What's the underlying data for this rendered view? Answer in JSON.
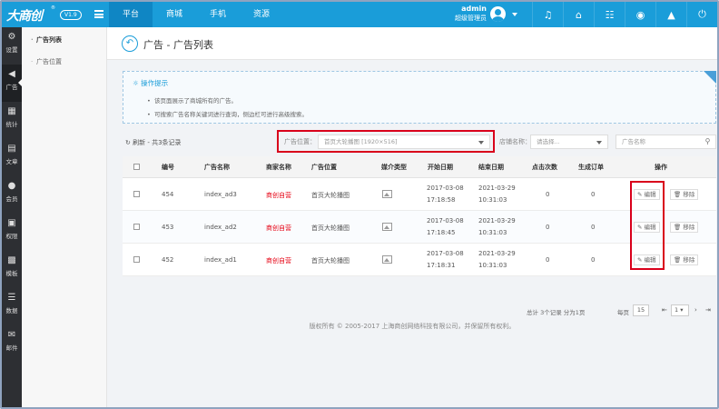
{
  "header": {
    "logo": "大商创",
    "logo_reg": "®",
    "version": "V1.9",
    "nav": [
      "平台",
      "商城",
      "手机",
      "资源"
    ],
    "user_name": "admin",
    "user_role": "超级管理员",
    "icons": [
      "bell-icon",
      "home-icon",
      "sitemap-icon",
      "palette-icon",
      "broom-icon",
      "power-icon"
    ]
  },
  "sidebar": {
    "items": [
      {
        "label": "设置",
        "icon": "gear-icon"
      },
      {
        "label": "广告",
        "icon": "speaker-icon"
      },
      {
        "label": "统计",
        "icon": "chart-icon"
      },
      {
        "label": "文章",
        "icon": "file-icon"
      },
      {
        "label": "会员",
        "icon": "user-icon"
      },
      {
        "label": "权限",
        "icon": "lock-icon"
      },
      {
        "label": "模板",
        "icon": "grid-icon"
      },
      {
        "label": "数据",
        "icon": "database-icon"
      },
      {
        "label": "邮件",
        "icon": "mail-icon"
      }
    ]
  },
  "submenu": {
    "items": [
      "广告列表",
      "广告位置"
    ]
  },
  "page": {
    "title": "广告 - 广告列表"
  },
  "tips": {
    "title": "操作提示",
    "lines": [
      "该页面展示了商城所有的广告。",
      "可搜索广告名称关键词进行查询，侧边栏可进行高级搜索。"
    ]
  },
  "toolbar": {
    "refresh": "刷新 - 共3条记录",
    "position_label": "广告位置：",
    "position_value": "首页大轮播图 [1920×516]",
    "shop_label": "店铺名称：",
    "shop_placeholder": "请选择...",
    "name_placeholder": "广告名称"
  },
  "table": {
    "headers": [
      "编号",
      "广告名称",
      "商家名称",
      "广告位置",
      "媒介类型",
      "开始日期",
      "结束日期",
      "点击次数",
      "生成订单",
      "操作"
    ],
    "rows": [
      {
        "id": "454",
        "name": "index_ad3",
        "shop": "商创自营",
        "position": "首页大轮播图",
        "start_date": "2017-03-08",
        "start_time": "17:18:58",
        "end_date": "2021-03-29",
        "end_time": "10:31:03",
        "clicks": "0",
        "orders": "0"
      },
      {
        "id": "453",
        "name": "index_ad2",
        "shop": "商创自营",
        "position": "首页大轮播图",
        "start_date": "2017-03-08",
        "start_time": "17:18:45",
        "end_date": "2021-03-29",
        "end_time": "10:31:03",
        "clicks": "0",
        "orders": "0"
      },
      {
        "id": "452",
        "name": "index_ad1",
        "shop": "商创自营",
        "position": "首页大轮播图",
        "start_date": "2017-03-08",
        "start_time": "17:18:31",
        "end_date": "2021-03-29",
        "end_time": "10:31:03",
        "clicks": "0",
        "orders": "0"
      }
    ],
    "edit_label": "编辑",
    "remove_label": "移除"
  },
  "pager": {
    "summary": "总计 3个记录 分为1页",
    "per_page_label": "每页",
    "per_page": "15",
    "page": "1"
  },
  "footer": "版权所有 © 2005-2017 上海商创网络科技有限公司，并保留所有权利。",
  "colors": {
    "primary": "#1a9dd9",
    "sidebar": "#2d2f33",
    "highlight": "#d9001b",
    "shop_text": "#e60012"
  }
}
